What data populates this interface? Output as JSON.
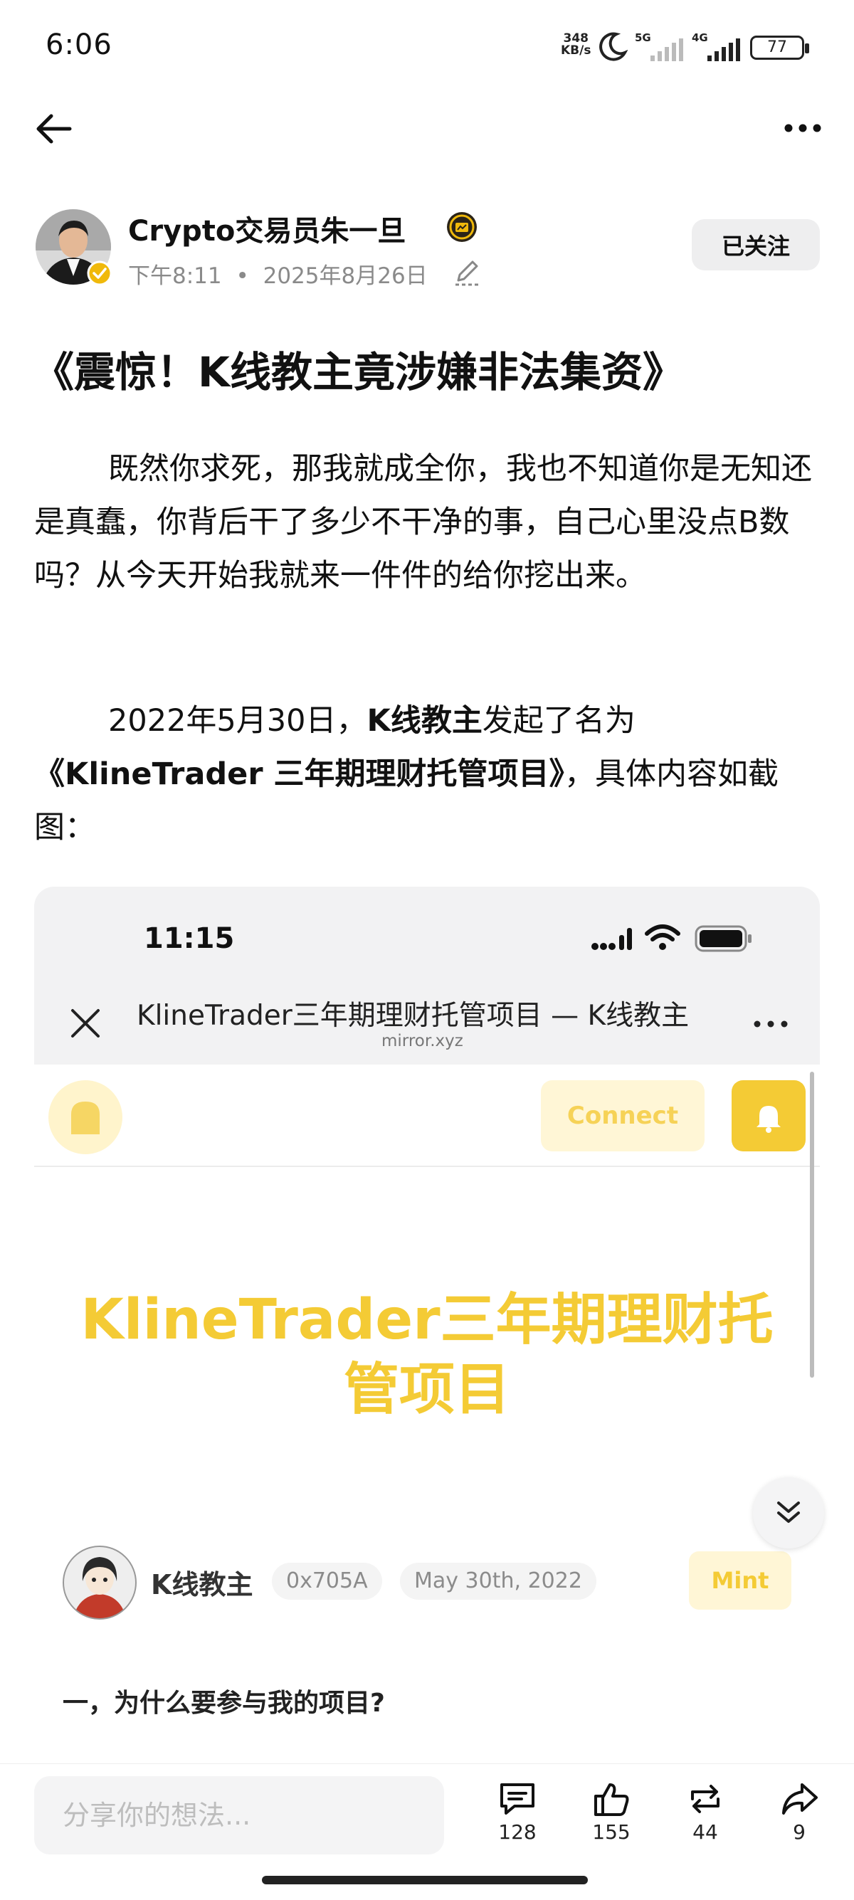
{
  "status_bar": {
    "time": "6:06",
    "net_speed_value": "348",
    "net_speed_unit": "KB/s",
    "signal1": "5G",
    "signal2": "4G",
    "battery": "77"
  },
  "post": {
    "author_name": "Crypto交易员朱一旦",
    "time": "下午8:11",
    "date": "2025年8月26日",
    "follow_label": "已关注",
    "title": "《震惊！K线教主竟涉嫌非法集资》",
    "para1": "既然你求死，那我就成全你，我也不知道你是无知还是真蠢，你背后干了多少不干净的事，自己心里没点B数吗？从今天开始我就来一件件的给你挖出来。",
    "para2_a": "2022年5月30日，",
    "para2_b": "K线教主",
    "para2_c": "发起了名为",
    "para2_d": "《KlineTrader 三年期理财托管项目》",
    "para2_e": "，具体内容如截图："
  },
  "screenshot": {
    "time": "11:15",
    "tab_title": "KlineTrader三年期理财托管项目 — K线教主",
    "url": "mirror.xyz",
    "connect_label": "Connect",
    "heading_line1": "KlineTrader三年期理财托",
    "heading_line2": "管项目",
    "author": "K线教主",
    "address": "0x705A",
    "date": "May 30th, 2022",
    "mint_label": "Mint",
    "subheading": "一，为什么要参与我的项目?"
  },
  "bottom_bar": {
    "placeholder": "分享你的想法...",
    "comments": "128",
    "likes": "155",
    "reposts": "44",
    "shares": "9"
  },
  "colors": {
    "accent_yellow": "#f4cb35",
    "badge_gold": "#f0b90b"
  }
}
